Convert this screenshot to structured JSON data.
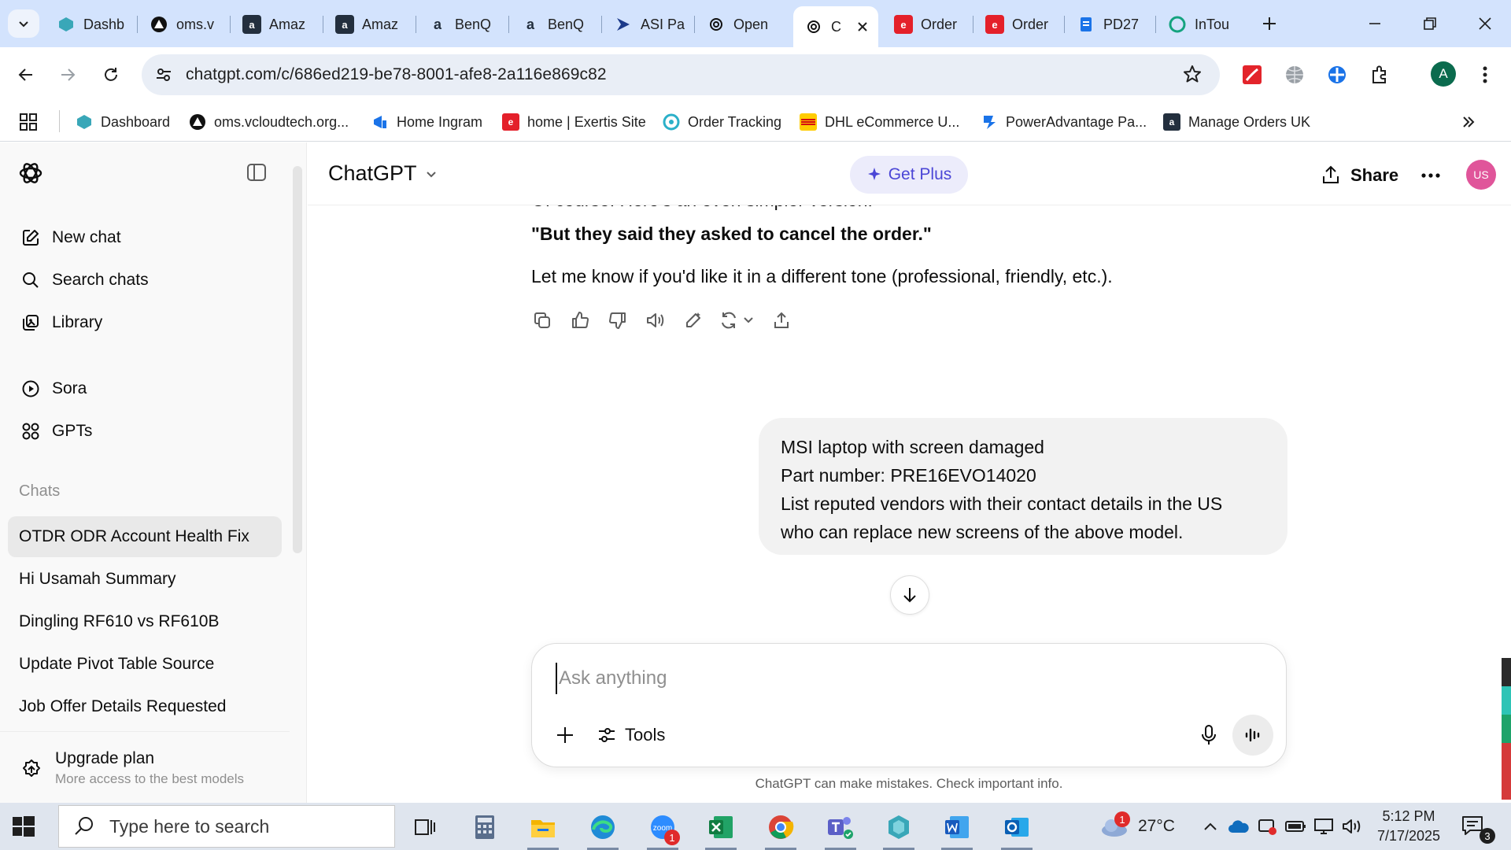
{
  "browser": {
    "tabs": [
      {
        "label": "Dashb",
        "icon": "dashboard-icon",
        "color": "#39a7b8"
      },
      {
        "label": "oms.v",
        "icon": "triangle-logo-icon",
        "color": "#111111"
      },
      {
        "label": "Amaz",
        "icon": "amazon-icon",
        "color": "#232f3e"
      },
      {
        "label": "Amaz",
        "icon": "amazon-icon",
        "color": "#232f3e"
      },
      {
        "label": "BenQ",
        "icon": "amazon-icon",
        "color": "#232f3e"
      },
      {
        "label": "BenQ",
        "icon": "amazon-icon",
        "color": "#232f3e"
      },
      {
        "label": "ASI Pa",
        "icon": "arrow-logo-icon",
        "color": "#1c3a8a"
      },
      {
        "label": "Open",
        "icon": "openai-icon",
        "color": "#111111"
      },
      {
        "label": "C",
        "icon": "openai-icon",
        "color": "#111111"
      },
      {
        "label": "Order",
        "icon": "exertis-icon",
        "color": "#e4202a"
      },
      {
        "label": "Order",
        "icon": "exertis-icon",
        "color": "#e4202a"
      },
      {
        "label": "PD27",
        "icon": "document-icon",
        "color": "#1a73e8"
      },
      {
        "label": "InTou",
        "icon": "intouch-icon",
        "color": "#14a37f"
      }
    ],
    "active_tab_index": 8,
    "url": "chatgpt.com/c/686ed219-be78-8001-afe8-2a116e869c82",
    "profile_initial": "A",
    "bookmarks": [
      {
        "label": "Dashboard",
        "icon": "dashboard-icon",
        "color": "#39a7b8"
      },
      {
        "label": "oms.vcloudtech.org...",
        "icon": "triangle-logo-icon",
        "color": "#111111"
      },
      {
        "label": "Home Ingram",
        "icon": "ingram-icon",
        "color": "#1a73e8"
      },
      {
        "label": "home | Exertis Site",
        "icon": "exertis-icon",
        "color": "#e4202a"
      },
      {
        "label": "Order Tracking",
        "icon": "tracking-icon",
        "color": "#2bb0c9"
      },
      {
        "label": "DHL eCommerce U...",
        "icon": "dhl-icon",
        "color": "#ffcc00"
      },
      {
        "label": "PowerAdvantage Pa...",
        "icon": "poweradvantage-icon",
        "color": "#1a73e8"
      },
      {
        "label": "Manage Orders UK",
        "icon": "amazon-icon",
        "color": "#232f3e"
      }
    ]
  },
  "sidebar": {
    "nav": [
      {
        "label": "New chat",
        "icon": "new-chat-icon"
      },
      {
        "label": "Search chats",
        "icon": "search-icon"
      },
      {
        "label": "Library",
        "icon": "library-icon"
      },
      {
        "label": "Sora",
        "icon": "play-circle-icon"
      },
      {
        "label": "GPTs",
        "icon": "grid-icon"
      }
    ],
    "chats_heading": "Chats",
    "chats": [
      "OTDR ODR Account Health Fix",
      "Hi Usamah Summary",
      "Dingling RF610 vs RF610B",
      "Update Pivot Table Source",
      "Job Offer Details Requested"
    ],
    "selected_chat_index": 0,
    "upgrade": {
      "title": "Upgrade plan",
      "subtitle": "More access to the best models"
    }
  },
  "header": {
    "model": "ChatGPT",
    "get_plus": "Get Plus",
    "share": "Share",
    "avatar_initials": "US",
    "avatar_color": "#e0559a"
  },
  "conversation": {
    "assistant": {
      "cut_line": "Of course! Here's an even simpler version:",
      "quote": "\"But they said they asked to cancel the order.\"",
      "closing": "Let me know if you'd like it in a different tone (professional, friendly, etc.)."
    },
    "user_message": [
      "MSI laptop with screen damaged",
      "Part number: PRE16EVO14020",
      "List reputed vendors with their contact details in the US",
      "who can replace new screens of the above model."
    ]
  },
  "composer": {
    "placeholder": "Ask anything",
    "tools_label": "Tools",
    "disclaimer": "ChatGPT can make mistakes. Check important info."
  },
  "taskbar": {
    "search_placeholder": "Type here to search",
    "zoom_badge": "1",
    "weather_badge": "1",
    "temperature": "27°C",
    "time": "5:12 PM",
    "date": "7/17/2025",
    "notification_count": "3"
  }
}
